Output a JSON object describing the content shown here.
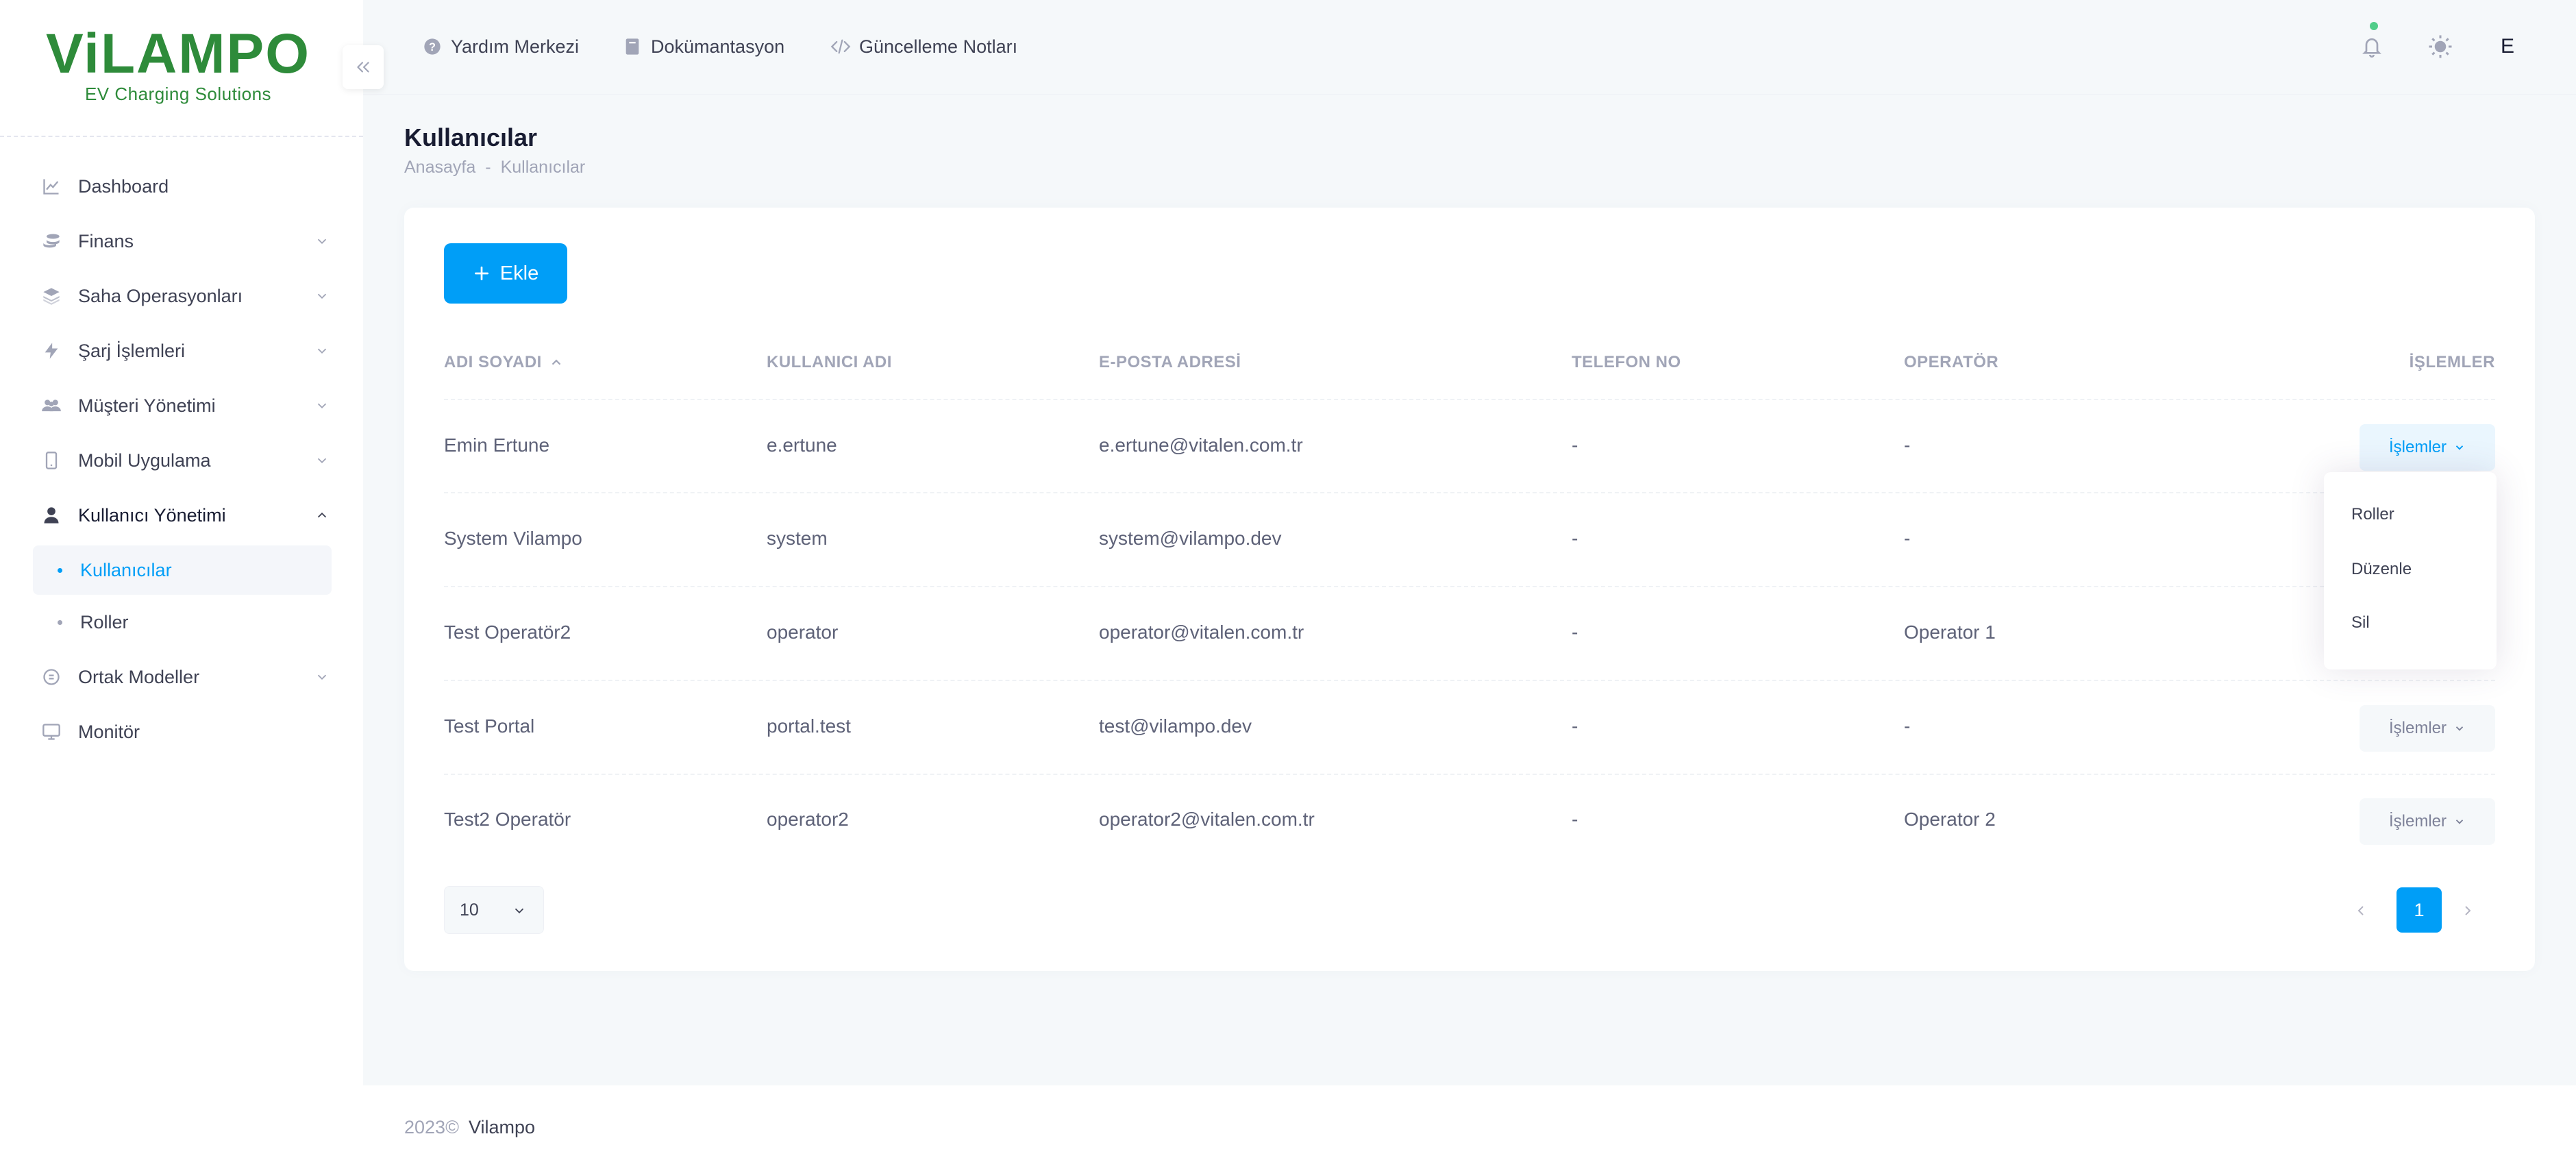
{
  "brand": {
    "name": "ViLAMPO",
    "tagline": "EV Charging Solutions",
    "color": "#2e8b3a"
  },
  "sidebar": {
    "items": [
      {
        "label": "Dashboard",
        "icon": "chart-line-icon"
      },
      {
        "label": "Finans",
        "icon": "coins-icon"
      },
      {
        "label": "Saha Operasyonları",
        "icon": "layers-icon"
      },
      {
        "label": "Şarj İşlemleri",
        "icon": "bolt-icon"
      },
      {
        "label": "Müşteri Yönetimi",
        "icon": "users-icon"
      },
      {
        "label": "Mobil Uygulama",
        "icon": "mobile-icon"
      },
      {
        "label": "Kullanıcı Yönetimi",
        "icon": "user-icon"
      },
      {
        "label": "Ortak Modeller",
        "icon": "circle-icon"
      },
      {
        "label": "Monitör",
        "icon": "monitor-icon"
      }
    ],
    "sub_items": [
      {
        "label": "Kullanıcılar",
        "active": true
      },
      {
        "label": "Roller",
        "active": false
      }
    ]
  },
  "header": {
    "links": [
      {
        "label": "Yardım Merkezi",
        "icon": "question-circle-icon"
      },
      {
        "label": "Dokümantasyon",
        "icon": "book-icon"
      },
      {
        "label": "Güncelleme Notları",
        "icon": "code-icon"
      }
    ],
    "user_initial": "E"
  },
  "page": {
    "title": "Kullanıcılar",
    "breadcrumb": [
      "Anasayfa",
      "-",
      "Kullanıcılar"
    ]
  },
  "toolbar": {
    "add_label": "Ekle"
  },
  "table": {
    "columns": [
      "ADI SOYADI",
      "KULLANICI ADI",
      "E-POSTA ADRESİ",
      "TELEFON NO",
      "OPERATÖR",
      "İŞLEMLER"
    ],
    "rows": [
      {
        "name": "Emin Ertune",
        "username": "e.ertune",
        "email": "e.ertune@vitalen.com.tr",
        "phone": "-",
        "operator": "-",
        "action": "İşlemler"
      },
      {
        "name": "System Vilampo",
        "username": "system",
        "email": "system@vilampo.dev",
        "phone": "-",
        "operator": "-",
        "action": "İşlemler"
      },
      {
        "name": "Test Operatör2",
        "username": "operator",
        "email": "operator@vitalen.com.tr",
        "phone": "-",
        "operator": "Operator 1",
        "action": "İşlemler"
      },
      {
        "name": "Test Portal",
        "username": "portal.test",
        "email": "test@vilampo.dev",
        "phone": "-",
        "operator": "-",
        "action": "İşlemler"
      },
      {
        "name": "Test2 Operatör",
        "username": "operator2",
        "email": "operator2@vitalen.com.tr",
        "phone": "-",
        "operator": "Operator 2",
        "action": "İşlemler"
      }
    ],
    "sort_column": "ADI SOYADI"
  },
  "dropdown": {
    "items": [
      "Roller",
      "Düzenle",
      "Sil"
    ]
  },
  "pagination": {
    "page_size": "10",
    "current_page": "1"
  },
  "footer": {
    "year": "2023©",
    "brand": "Vilampo"
  },
  "colors": {
    "primary": "#009ef7",
    "background": "#f5f8fa",
    "notification": "#50cd89"
  }
}
